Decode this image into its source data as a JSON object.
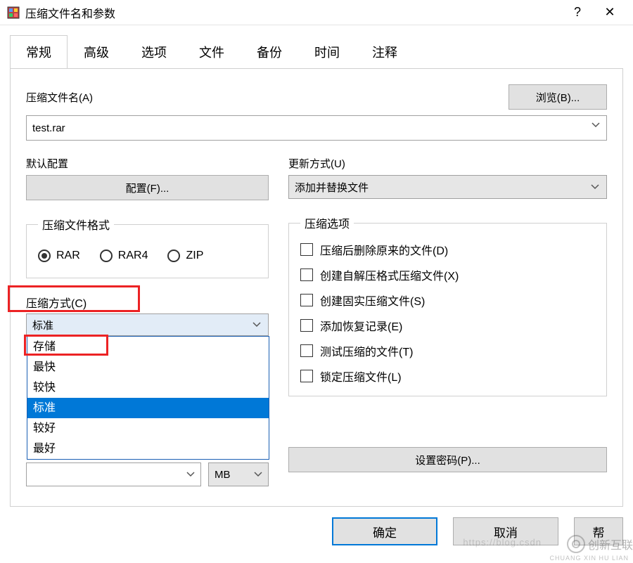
{
  "title": "压缩文件名和参数",
  "tabs": [
    "常规",
    "高级",
    "选项",
    "文件",
    "备份",
    "时间",
    "注释"
  ],
  "active_tab": 0,
  "filename_label": "压缩文件名(A)",
  "browse_label": "浏览(B)...",
  "filename_value": "test.rar",
  "default_cfg_label": "默认配置",
  "cfg_button": "配置(F)...",
  "update_label": "更新方式(U)",
  "update_value": "添加并替换文件",
  "format_legend": "压缩文件格式",
  "formats": [
    {
      "label": "RAR",
      "checked": true
    },
    {
      "label": "RAR4",
      "checked": false
    },
    {
      "label": "ZIP",
      "checked": false
    }
  ],
  "options_legend": "压缩选项",
  "options": [
    "压缩后删除原来的文件(D)",
    "创建自解压格式压缩文件(X)",
    "创建固实压缩文件(S)",
    "添加恢复记录(E)",
    "测试压缩的文件(T)",
    "锁定压缩文件(L)"
  ],
  "method_label": "压缩方式(C)",
  "method_value": "标准",
  "method_items": [
    "存储",
    "最快",
    "较快",
    "标准",
    "较好",
    "最好"
  ],
  "method_selected_index": 3,
  "split_unit": "MB",
  "setpw_label": "设置密码(P)...",
  "footer": {
    "ok": "确定",
    "cancel": "取消",
    "help": "帮"
  },
  "watermark": "创新互联"
}
